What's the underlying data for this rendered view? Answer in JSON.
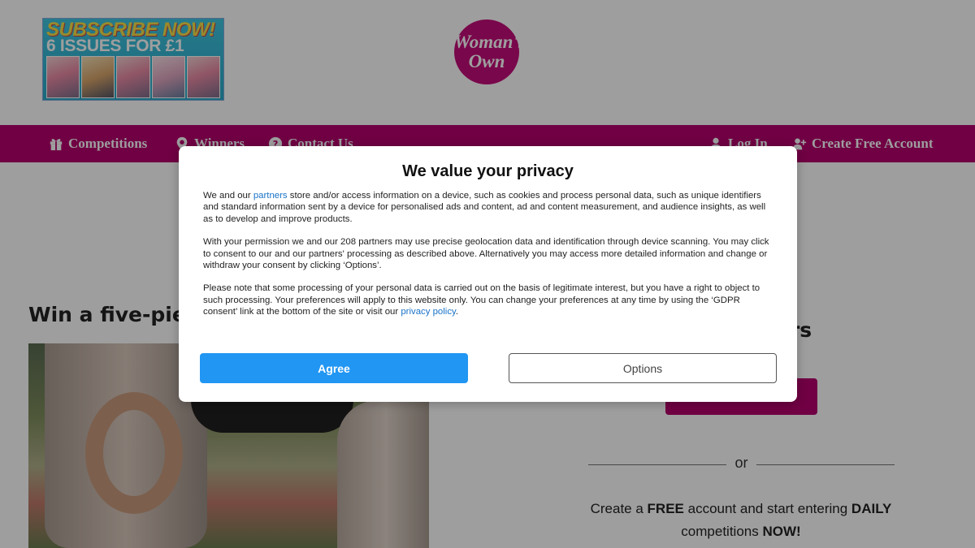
{
  "header": {
    "promo": {
      "line1": "SUBSCRIBE NOW!",
      "line2": "6 ISSUES FOR £1"
    },
    "logo": {
      "line1": "Woman's",
      "line2": "Own"
    }
  },
  "nav": {
    "left": [
      {
        "label": "Competitions",
        "icon": "gift-icon"
      },
      {
        "label": "Winners",
        "icon": "map-pin-icon"
      },
      {
        "label": "Contact Us",
        "icon": "question-circle-icon"
      }
    ],
    "right": [
      {
        "label": "Log In",
        "icon": "user-icon"
      },
      {
        "label": "Create Free Account",
        "icon": "user-plus-icon"
      }
    ]
  },
  "main": {
    "competition_title": "Win a five-piec",
    "right_title": "ers",
    "or_text": "or",
    "create": {
      "p1": "Create a ",
      "b1": "FREE",
      "p2": " account and start entering ",
      "b2": "DAILY",
      "p3": " competitions ",
      "b3": "NOW!"
    }
  },
  "dialog": {
    "title": "We value your privacy",
    "para1_before": "We and our ",
    "para1_link": "partners",
    "para1_after": " store and/or access information on a device, such as cookies and process personal data, such as unique identifiers and standard information sent by a device for personalised ads and content, ad and content measurement, and audience insights, as well as to develop and improve products.",
    "para2": "With your permission we and our 208 partners may use precise geolocation data and identification through device scanning. You may click to consent to our and our partners' processing as described above. Alternatively you may access more detailed information and change or withdraw your consent by clicking ‘Options’.",
    "para3_before": "Please note that some processing of your personal data is carried out on the basis of legitimate interest, but you have a right to object to such processing. Your preferences will apply to this website only. You can change your preferences at any time by using the ‘GDPR consent’ link at the bottom of the site or visit our ",
    "para3_link": "privacy policy",
    "para3_after": ".",
    "agree_label": "Agree",
    "options_label": "Options"
  },
  "colors": {
    "brand": "#b5006c",
    "agree": "#2196f3",
    "link": "#1a73c8"
  }
}
